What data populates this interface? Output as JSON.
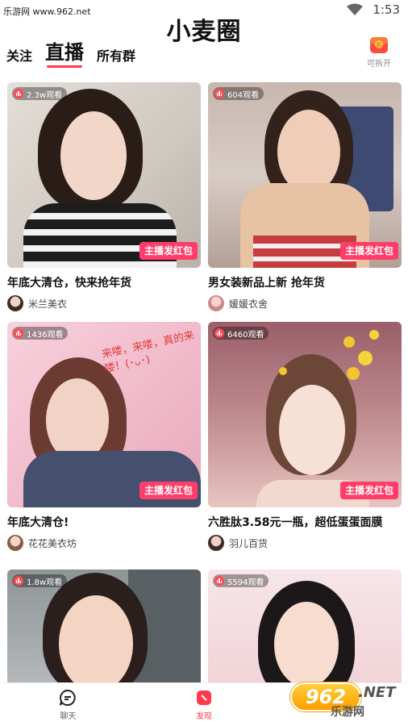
{
  "status_bar": {
    "watermark": "乐游网 www.962.net",
    "time": "1:53"
  },
  "app": {
    "title": "小麦圈"
  },
  "tabs": [
    {
      "label": "关注",
      "active": false
    },
    {
      "label": "直播",
      "active": true
    },
    {
      "label": "所有群",
      "active": false
    }
  ],
  "openable": {
    "label": "可拆开",
    "icon": "gift-box-icon"
  },
  "badge_label": "主播发红包",
  "cards": [
    {
      "viewers": "2.3w观看",
      "title": "年底大清仓，快来抢年货",
      "author": "米兰美衣",
      "has_redpack": true,
      "colors": {
        "bg": "#d9d3cd",
        "accent": "#2c2c2c"
      }
    },
    {
      "viewers": "604观看",
      "title": "男女装新品上新 抢年货",
      "author": "媛媛衣舍",
      "has_redpack": true,
      "colors": {
        "bg": "#cfc2ba",
        "accent": "#c9a07d"
      }
    },
    {
      "viewers": "1436观看",
      "title": "年底大清仓!",
      "author": "花花美衣坊",
      "has_redpack": true,
      "overlay_text": "来喽，来喽，真的来喽！(･ᴗ･)",
      "colors": {
        "bg": "#f2c3d2",
        "accent": "#3f4d6b"
      }
    },
    {
      "viewers": "6460观看",
      "title": "六胜肽3.58元一瓶，超低蛋蛋面膜",
      "author": "羽儿百货",
      "has_redpack": true,
      "colors": {
        "bg": "#b8838a",
        "accent": "#e8c8b5"
      }
    },
    {
      "viewers": "1.8w观看",
      "title": "",
      "author": "",
      "has_redpack": false,
      "colors": {
        "bg": "#9ea2a5",
        "accent": "#2a2221"
      }
    },
    {
      "viewers": "5594观看",
      "title": "",
      "author": "",
      "has_redpack": false,
      "colors": {
        "bg": "#f4dfe2",
        "accent": "#1f1a1b"
      }
    }
  ],
  "bottom_nav": [
    {
      "label": "聊天",
      "icon": "chat-icon",
      "active": false
    },
    {
      "label": "发现",
      "icon": "discover-icon",
      "active": true
    }
  ],
  "site_logo": {
    "number": "962",
    "suffix": ".NET",
    "name": "乐游网"
  }
}
